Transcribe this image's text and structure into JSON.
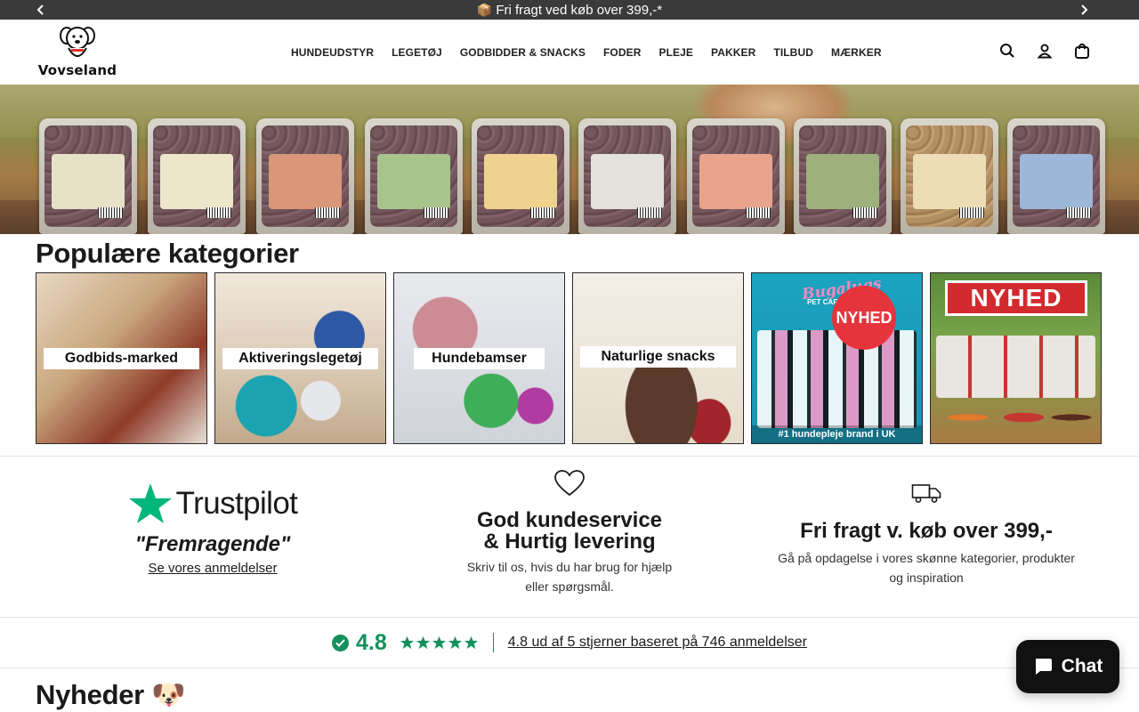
{
  "announcement": {
    "icon": "package-icon",
    "text": "Fri fragt ved køb over 399,-*"
  },
  "header": {
    "logo_text": "Vovseland",
    "nav": [
      "HUNDEUDSTYR",
      "LEGETØJ",
      "GODBIDDER & SNACKS",
      "FODER",
      "PLEJE",
      "PAKKER",
      "TILBUD",
      "MÆRKER"
    ],
    "icons": [
      "search-icon",
      "account-icon",
      "cart-icon"
    ]
  },
  "popular": {
    "title": "Populære kategorier",
    "categories": [
      {
        "label": "Godbids-marked"
      },
      {
        "label": "Aktiveringslegetøj"
      },
      {
        "label": "Hundebamser"
      },
      {
        "label": "Naturlige snacks"
      },
      {
        "label": "",
        "brand": "Bugalugs",
        "sub": "PET CARE",
        "badge": "NYHED",
        "footer": "#1 hundepleje brand i UK"
      },
      {
        "label": "",
        "badge": "NYHED"
      }
    ]
  },
  "features": {
    "trustpilot": {
      "logo": "Trustpilot",
      "quote": "\"Fremragende\"",
      "link": "Se vores anmeldelser"
    },
    "service": {
      "heading_line1": "God kundeservice",
      "heading_line2": "& Hurtig levering",
      "text_line1": "Skriv til os, hvis du har brug for hjælp",
      "text_line2": "eller spørgsmål."
    },
    "shipping": {
      "heading": "Fri fragt v. køb over 399,-",
      "text_line1": "Gå på opdagelse i vores skønne kategorier, produkter",
      "text_line2": "og inspiration"
    }
  },
  "rating": {
    "score": "4.8",
    "stars": 5,
    "text": "4.8 ud af 5 stjerner baseret på 746 anmeldelser"
  },
  "news": {
    "title": "Nyheder",
    "emoji": "🐶"
  },
  "chat": {
    "label": "Chat"
  },
  "colors": {
    "announcement_bg": "#3a3a3a",
    "rating_green": "#14915b",
    "trustpilot_green": "#00b67a",
    "chat_bg": "#111111"
  }
}
